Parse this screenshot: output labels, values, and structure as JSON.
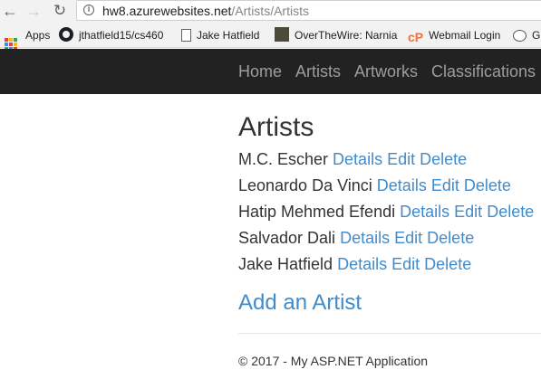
{
  "browser": {
    "url_host": "hw8.azurewebsites.net",
    "url_path": "/Artists/Artists"
  },
  "bookmarks": [
    {
      "label": "Apps",
      "icon": "apps-grid-icon"
    },
    {
      "label": "jthatfield15/cs460",
      "icon": "github-icon"
    },
    {
      "label": "Jake Hatfield",
      "icon": "page-icon"
    },
    {
      "label": "OverTheWire: Narnia",
      "icon": "overthewire-icon"
    },
    {
      "label": "Webmail Login",
      "icon": "cpanel-icon"
    },
    {
      "label": "G",
      "icon": "reddit-icon"
    }
  ],
  "navbar": {
    "links": [
      "Home",
      "Artists",
      "Artworks",
      "Classifications"
    ]
  },
  "main": {
    "title": "Artists",
    "action_labels": {
      "details": "Details",
      "edit": "Edit",
      "delete": "Delete"
    },
    "artists": [
      {
        "name": "M.C. Escher"
      },
      {
        "name": "Leonardo Da Vinci"
      },
      {
        "name": "Hatip Mehmed Efendi"
      },
      {
        "name": "Salvador Dali"
      },
      {
        "name": "Jake Hatfield"
      }
    ],
    "add_link": "Add an Artist"
  },
  "footer": {
    "text": "© 2017 - My ASP.NET Application"
  },
  "colors": {
    "navbar_bg": "#222222",
    "navbar_link": "#9d9d9d",
    "link": "#428bca",
    "text": "#333333"
  }
}
